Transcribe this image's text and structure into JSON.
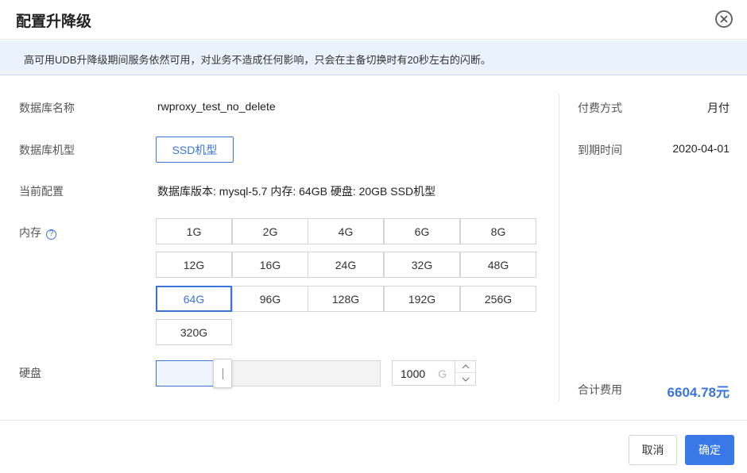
{
  "dialog": {
    "title": "配置升降级",
    "notice": "高可用UDB升降级期间服务依然可用，对业务不造成任何影响，只会在主备切换时有20秒左右的闪断。"
  },
  "form": {
    "db_name_label": "数据库名称",
    "db_name_value": "rwproxy_test_no_delete",
    "db_type_label": "数据库机型",
    "db_type_button": "SSD机型",
    "current_config_label": "当前配置",
    "current_config_value": "数据库版本: mysql-5.7 内存: 64GB 硬盘: 20GB SSD机型",
    "memory_label": "内存",
    "memory_help": "?",
    "memory_options": [
      "1G",
      "2G",
      "4G",
      "6G",
      "8G",
      "12G",
      "16G",
      "24G",
      "32G",
      "48G",
      "64G",
      "96G",
      "128G",
      "192G",
      "256G",
      "320G"
    ],
    "memory_selected": "64G",
    "disk_label": "硬盘",
    "disk_value": "1000",
    "disk_unit": "G",
    "disk_slider_fraction": 0.27
  },
  "summary": {
    "payment_label": "付费方式",
    "payment_value": "月付",
    "expire_label": "到期时间",
    "expire_value": "2020-04-01",
    "total_label": "合计费用",
    "total_value": "6604.78元"
  },
  "footer": {
    "cancel_label": "取消",
    "ok_label": "确定"
  },
  "colors": {
    "accent": "#3a75d6",
    "primary_button": "#3b78e7",
    "notice_bg": "#eaf3fd"
  }
}
